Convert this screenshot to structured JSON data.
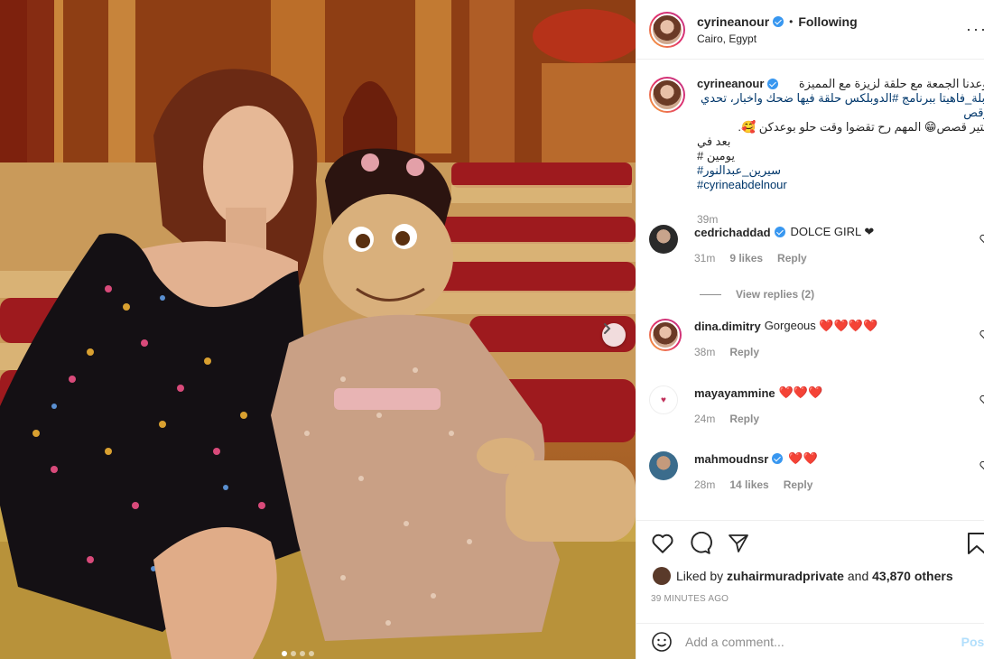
{
  "header": {
    "username": "cyrineanour",
    "separator": "•",
    "follow_status": "Following",
    "location": "Cairo, Egypt",
    "more_icon": "more-dots-icon"
  },
  "caption": {
    "username": "cyrineanour",
    "lines": [
      "موعدنا الجمعة مع حلقة لزيزة مع المميزة",
      "#ابلة_فاهيتا ببرنامج #الدوبلكس حلقة فيها ضحك واخبار، تحدي ورقص",
      "وكتير قصص😁 المهم رح تقضوا وقت حلو بوعدكن 🥰.",
      "بعد في يومين #",
      "#سيرين_عبدالنور",
      "#cyrineabdelnour"
    ],
    "time": "39m"
  },
  "comments": [
    {
      "username": "cedrichaddad",
      "verified": true,
      "text": "DOLCE GIRL ❤",
      "time": "31m",
      "likes": "9 likes",
      "reply": "Reply"
    },
    {
      "username": "dina.dimitry",
      "verified": false,
      "text": "Gorgeous ❤️❤️❤️❤️",
      "time": "38m",
      "likes": "",
      "reply": "Reply"
    },
    {
      "username": "mayayammine",
      "verified": false,
      "text": "❤️❤️❤️",
      "time": "24m",
      "likes": "",
      "reply": "Reply"
    },
    {
      "username": "mahmoudnsr",
      "verified": true,
      "text": "❤️❤️",
      "time": "28m",
      "likes": "14 likes",
      "reply": "Reply"
    }
  ],
  "view_replies": "View replies (2)",
  "actions": {
    "like_icon": "heart-icon",
    "comment_icon": "comment-bubble-icon",
    "share_icon": "paper-plane-icon",
    "save_icon": "bookmark-icon"
  },
  "likes": {
    "prefix": "Liked by",
    "user": "zuhairmuradprivate",
    "middle": "and",
    "others": "43,870 others"
  },
  "post_time": "39 minutes ago",
  "add_comment": {
    "placeholder": "Add a comment...",
    "post_label": "Post",
    "emoji_icon": "smiley-icon"
  },
  "carousel": {
    "next_icon": "chevron-right-icon",
    "slide_count": 4,
    "active_index": 0
  },
  "colors": {
    "verified": "#3897f0",
    "link": "#00376b",
    "muted": "#8e8e8e",
    "post_disabled": "#b2dffc"
  }
}
